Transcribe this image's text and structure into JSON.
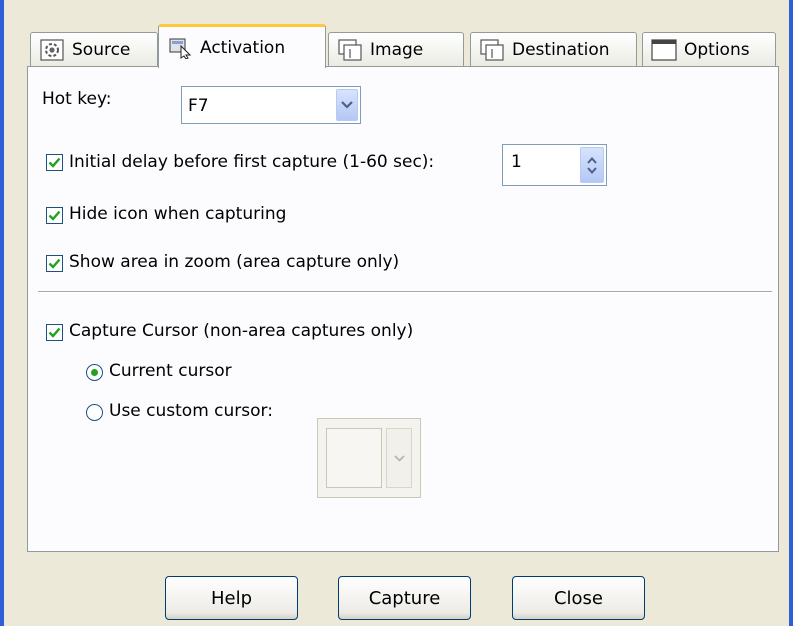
{
  "tabs": [
    {
      "label": "Source",
      "icon": "gear-icon",
      "active": false
    },
    {
      "label": "Activation",
      "icon": "activation-icon",
      "active": true
    },
    {
      "label": "Image",
      "icon": "image-icon",
      "active": false
    },
    {
      "label": "Destination",
      "icon": "destination-icon",
      "active": false
    },
    {
      "label": "Options",
      "icon": "window-icon",
      "active": false
    }
  ],
  "activation": {
    "hotkey_label": "Hot key:",
    "hotkey_value": "F7",
    "delay_label": "Initial delay before first capture (1-60 sec):",
    "delay_checked": true,
    "delay_value": "1",
    "hide_icon_label": "Hide icon when capturing",
    "hide_icon_checked": true,
    "show_zoom_label": "Show area in zoom (area capture only)",
    "show_zoom_checked": true,
    "capture_cursor_label": "Capture Cursor (non-area captures only)",
    "capture_cursor_checked": true,
    "radio_current_label": "Current cursor",
    "radio_current_selected": true,
    "radio_custom_label": "Use custom cursor:",
    "radio_custom_selected": false
  },
  "buttons": {
    "help": "Help",
    "capture": "Capture",
    "close": "Close"
  },
  "colors": {
    "dialog_bg": "#ece9d8",
    "panel_bg": "#fcfcfe",
    "active_tab_accent": "#ffc83c",
    "check_mark": "#21a121",
    "window_border": "#2f5fd8"
  }
}
